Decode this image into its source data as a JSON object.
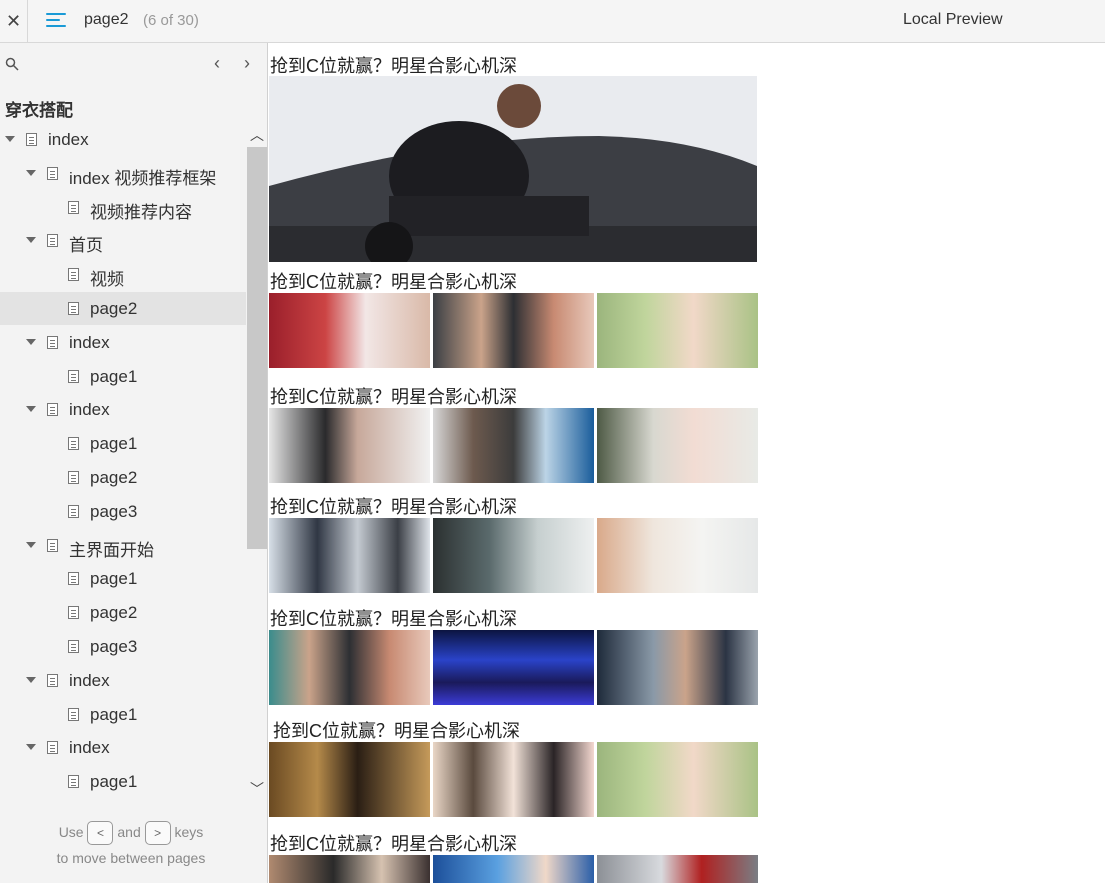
{
  "topbar": {
    "close_glyph": "✕",
    "page_name": "page2",
    "page_count": "(6 of 30)",
    "preview_label": "Local Preview"
  },
  "sidebar": {
    "prev_glyph": "‹",
    "next_glyph": "›",
    "project_title": "穿衣搭配",
    "tree": [
      {
        "label": "index",
        "level": 0,
        "expanded": true
      },
      {
        "label": "index 视频推荐框架",
        "level": 1,
        "expanded": true
      },
      {
        "label": "视频推荐内容",
        "level": 2
      },
      {
        "label": "首页",
        "level": 1,
        "expanded": true
      },
      {
        "label": "视频",
        "level": 2
      },
      {
        "label": "page2",
        "level": 2,
        "selected": true
      },
      {
        "label": "index",
        "level": 1,
        "expanded": true
      },
      {
        "label": "page1",
        "level": 2
      },
      {
        "label": "index",
        "level": 1,
        "expanded": true
      },
      {
        "label": "page1",
        "level": 2
      },
      {
        "label": "page2",
        "level": 2
      },
      {
        "label": "page3",
        "level": 2
      },
      {
        "label": "主界面开始",
        "level": 1,
        "expanded": true
      },
      {
        "label": "page1",
        "level": 2
      },
      {
        "label": "page2",
        "level": 2
      },
      {
        "label": "page3",
        "level": 2
      },
      {
        "label": "index",
        "level": 1,
        "expanded": true
      },
      {
        "label": "page1",
        "level": 2
      },
      {
        "label": "index",
        "level": 1,
        "expanded": true
      },
      {
        "label": "page1",
        "level": 2
      }
    ],
    "hint": {
      "use": "Use",
      "and": "and",
      "keys": "keys",
      "line2": "to move between pages",
      "key_prev": "<",
      "key_next": ">"
    }
  },
  "content": {
    "sections": [
      {
        "headline": "抢到C位就赢？明星合影心机深"
      },
      {
        "headline": "抢到C位就赢？明星合影心机深"
      },
      {
        "headline": "抢到C位就赢？明星合影心机深"
      },
      {
        "headline": "抢到C位就赢？明星合影心机深"
      },
      {
        "headline": "抢到C位就赢？明星合影心机深"
      },
      {
        "headline": "抢到C位就赢？明星合影心机深"
      },
      {
        "headline": "抢到C位就赢？明星合影心机深"
      }
    ]
  },
  "colors": {
    "accent": "#1a9ad6",
    "sidebar_bg": "#f3f3f3",
    "selected_row": "#e3e3e3"
  }
}
